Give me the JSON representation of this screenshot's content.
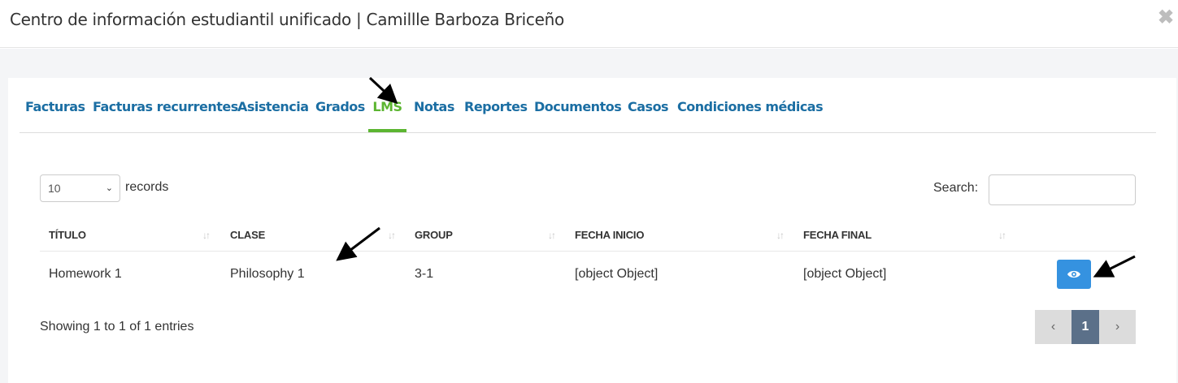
{
  "modal": {
    "title": "Centro de información estudiantil unificado | Camillle Barboza Briceño",
    "close_glyph": "✖"
  },
  "tabs": [
    {
      "label": "Facturas",
      "active": false
    },
    {
      "label": "Facturas recurrentes",
      "active": false
    },
    {
      "label": "Asistencia",
      "active": false
    },
    {
      "label": "Grados",
      "active": false
    },
    {
      "label": "LMS",
      "active": true
    },
    {
      "label": "Notas",
      "active": false
    },
    {
      "label": "Reportes",
      "active": false
    },
    {
      "label": "Documentos",
      "active": false
    },
    {
      "label": "Casos",
      "active": false
    },
    {
      "label": "Condiciones médicas",
      "active": false
    }
  ],
  "table_controls": {
    "length_value": "10",
    "records_label": "records",
    "search_label": "Search:",
    "search_value": ""
  },
  "table": {
    "headers": [
      "TÍTULO",
      "CLASE",
      "GROUP",
      "FECHA INICIO",
      "FECHA FINAL"
    ],
    "rows": [
      {
        "titulo": "Homework 1",
        "clase": "Philosophy 1",
        "group": "3-1",
        "fecha_inicio": "[object Object]",
        "fecha_final": "[object Object]"
      }
    ]
  },
  "footer": {
    "info": "Showing 1 to 1 of 1 entries",
    "prev_glyph": "‹",
    "current_page": "1",
    "next_glyph": "›"
  },
  "colors": {
    "tab_link": "#1b6ea3",
    "tab_active": "#5cb531",
    "view_button": "#3592e0",
    "page_current": "#5b7089"
  },
  "icons": {
    "sort": "sort-arrows-icon",
    "view": "eye-icon",
    "close": "close-icon",
    "annotation": "annotation-arrow-icon"
  }
}
